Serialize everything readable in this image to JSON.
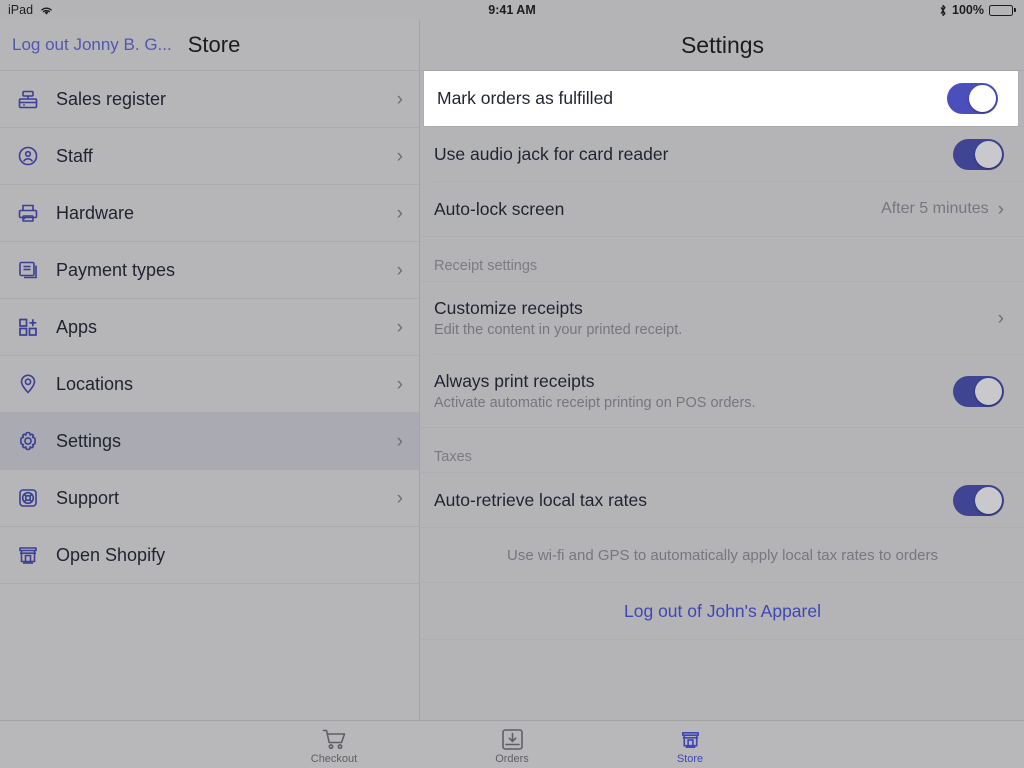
{
  "status_bar": {
    "device": "iPad",
    "wifi_icon": "wifi-icon",
    "time": "9:41 AM",
    "bluetooth_icon": "bluetooth-icon",
    "battery_percent": "100%",
    "battery_icon": "battery-full-icon"
  },
  "sidebar": {
    "logout_user_label": "Log out Jonny B. G...",
    "title": "Store",
    "items": [
      {
        "label": "Sales register",
        "icon": "cash-register-icon",
        "chevron": "›",
        "selected": false
      },
      {
        "label": "Staff",
        "icon": "staff-avatar-icon",
        "chevron": "›",
        "selected": false
      },
      {
        "label": "Hardware",
        "icon": "printer-icon",
        "chevron": "›",
        "selected": false
      },
      {
        "label": "Payment types",
        "icon": "payment-cards-icon",
        "chevron": "›",
        "selected": false
      },
      {
        "label": "Apps",
        "icon": "apps-grid-plus-icon",
        "chevron": "›",
        "selected": false
      },
      {
        "label": "Locations",
        "icon": "map-pin-icon",
        "chevron": "›",
        "selected": false
      },
      {
        "label": "Settings",
        "icon": "gear-icon",
        "chevron": "›",
        "selected": true
      },
      {
        "label": "Support",
        "icon": "life-ring-icon",
        "chevron": "›",
        "selected": false
      },
      {
        "label": "Open Shopify",
        "icon": "storefront-icon",
        "chevron": "",
        "selected": false
      }
    ]
  },
  "main": {
    "title": "Settings",
    "rows": {
      "mark_orders": {
        "title": "Mark orders as fulfilled",
        "toggle": "on",
        "highlighted": true
      },
      "audio_jack": {
        "title": "Use audio jack for card reader",
        "toggle": "on"
      },
      "auto_lock": {
        "title": "Auto-lock screen",
        "value": "After 5 minutes",
        "chevron": "›"
      }
    },
    "receipt_section": {
      "header": "Receipt settings",
      "customize": {
        "title": "Customize receipts",
        "subtitle": "Edit the content in your printed receipt.",
        "chevron": "›"
      },
      "always_print": {
        "title": "Always print receipts",
        "subtitle": "Activate automatic receipt printing on POS orders.",
        "toggle": "on"
      }
    },
    "taxes_section": {
      "header": "Taxes",
      "auto_retrieve": {
        "title": "Auto-retrieve local tax rates",
        "toggle": "on"
      },
      "footnote": "Use wi-fi and GPS to automatically apply local tax rates to orders"
    },
    "logout_store_label": "Log out of John's Apparel"
  },
  "tabbar": {
    "tabs": [
      {
        "label": "Checkout",
        "icon": "shopping-cart-icon",
        "active": false
      },
      {
        "label": "Orders",
        "icon": "orders-inbox-icon",
        "active": false
      },
      {
        "label": "Store",
        "icon": "storefront-icon",
        "active": true
      }
    ]
  },
  "colors": {
    "accent": "#4a4fbc",
    "link": "#4046b4",
    "background": "#b4b4b7",
    "sidebar_background": "#b6b6b9",
    "selected_row": "#aaaab2",
    "highlight_row": "#ffffff",
    "text_primary": "#1f2430",
    "text_secondary": "#76767e"
  }
}
